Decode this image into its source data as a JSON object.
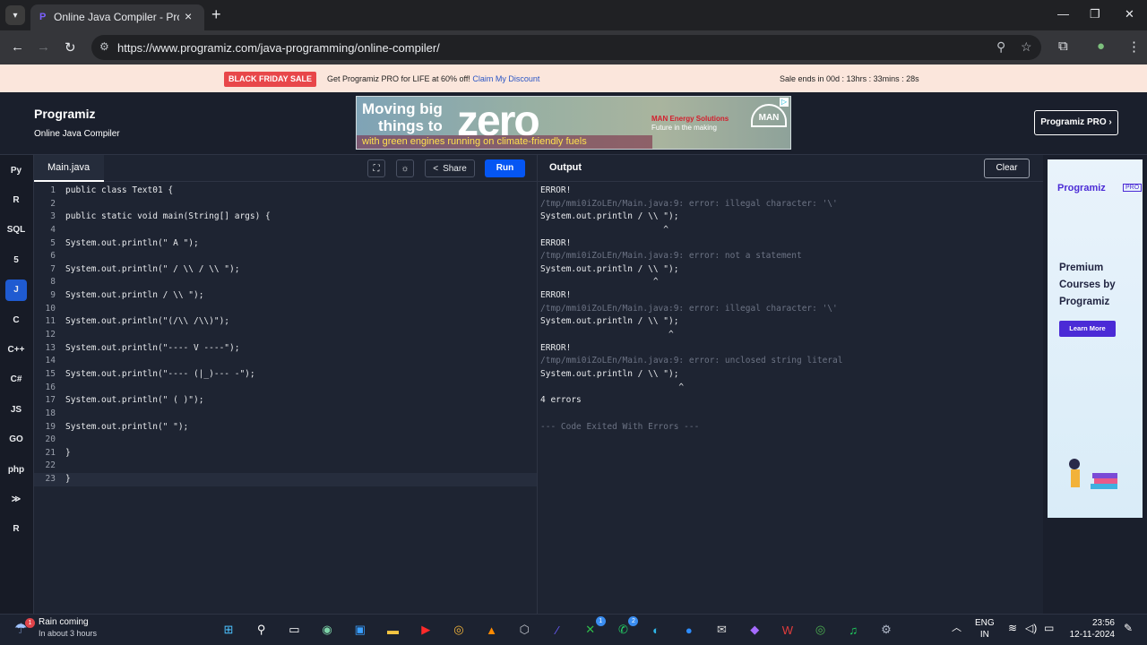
{
  "browser": {
    "tab_title": "Online Java Compiler - Program",
    "url": "https://www.programiz.com/java-programming/online-compiler/"
  },
  "promo": {
    "badge": "BLACK FRIDAY SALE",
    "message": "Get Programiz PRO for LIFE at 60% off!",
    "link": "Claim My Discount",
    "countdown": "Sale ends in 00d : 13hrs : 33mins : 28s"
  },
  "header": {
    "logo": "Programiz",
    "subtitle": "Online Java Compiler",
    "pro_button": "Programiz PRO ›"
  },
  "ad": {
    "line1": "Moving big",
    "line2": "things to",
    "big": "zero",
    "tagline": "with green engines running on climate-friendly fuels",
    "brand": "MAN Energy Solutions",
    "brand_sub": "Future in the making",
    "man": "MAN"
  },
  "languages": [
    {
      "label": "Py",
      "icon": "python-icon"
    },
    {
      "label": "R",
      "icon": "r-icon"
    },
    {
      "label": "SQL",
      "icon": "database-icon"
    },
    {
      "label": "5",
      "icon": "html5-icon"
    },
    {
      "label": "J",
      "icon": "java-icon"
    },
    {
      "label": "C",
      "icon": "c-icon"
    },
    {
      "label": "C++",
      "icon": "cpp-icon"
    },
    {
      "label": "C#",
      "icon": "csharp-icon"
    },
    {
      "label": "JS",
      "icon": "js-icon"
    },
    {
      "label": "GO",
      "icon": "go-icon"
    },
    {
      "label": "php",
      "icon": "php-icon"
    },
    {
      "label": "≫",
      "icon": "swift-icon"
    },
    {
      "label": "R",
      "icon": "rust-icon"
    }
  ],
  "editor": {
    "file_tab": "Main.java",
    "share": "Share",
    "run": "Run",
    "lines": [
      "public class Text01 {",
      "",
      "public static void main(String[] args) {",
      "",
      "System.out.println(\" A \");",
      "",
      "System.out.println(\" / \\\\ / \\\\ \");",
      "",
      "System.out.println / \\\\ \");",
      "",
      "System.out.println(\"(/\\\\ /\\\\)\");",
      "",
      "System.out.println(\"---- V ----\");",
      "",
      "System.out.println(\"---- (|_)--- -\");",
      "",
      "System.out.println(\" ( )\");",
      "",
      "System.out.println(\" \");",
      "",
      "}",
      "",
      "}"
    ]
  },
  "output": {
    "title": "Output",
    "clear": "Clear",
    "lines": [
      {
        "text": "ERROR!",
        "dim": false
      },
      {
        "text": "/tmp/mmi0iZoLEn/Main.java:9: error: illegal character: '\\'",
        "dim": true
      },
      {
        "text": "System.out.println / \\\\ \");",
        "dim": false
      },
      {
        "text": "                        ^",
        "dim": false
      },
      {
        "text": "ERROR!",
        "dim": false
      },
      {
        "text": "/tmp/mmi0iZoLEn/Main.java:9: error: not a statement",
        "dim": true
      },
      {
        "text": "System.out.println / \\\\ \");",
        "dim": false
      },
      {
        "text": "                      ^",
        "dim": false
      },
      {
        "text": "ERROR!",
        "dim": false
      },
      {
        "text": "/tmp/mmi0iZoLEn/Main.java:9: error: illegal character: '\\'",
        "dim": true
      },
      {
        "text": "System.out.println / \\\\ \");",
        "dim": false
      },
      {
        "text": "                         ^",
        "dim": false
      },
      {
        "text": "ERROR!",
        "dim": false
      },
      {
        "text": "/tmp/mmi0iZoLEn/Main.java:9: error: unclosed string literal",
        "dim": true
      },
      {
        "text": "System.out.println / \\\\ \");",
        "dim": false
      },
      {
        "text": "                           ^",
        "dim": false
      },
      {
        "text": "4 errors",
        "dim": false
      },
      {
        "text": "",
        "dim": false
      },
      {
        "text": "--- Code Exited With Errors ---",
        "dim": true
      }
    ]
  },
  "side_ad": {
    "logo": "Programiz",
    "pro": "PRO",
    "headline": "Premium Courses by Programiz",
    "button": "Learn More"
  },
  "taskbar": {
    "weather_title": "Rain coming",
    "weather_sub": "In about 3 hours",
    "weather_badge": "1",
    "lang_top": "ENG",
    "lang_bottom": "IN",
    "time": "23:56",
    "date": "12-11-2024",
    "apps": [
      {
        "name": "start-icon",
        "glyph": "⊞",
        "color": "#4cc2ff",
        "badge": ""
      },
      {
        "name": "search-icon",
        "glyph": "⚲",
        "color": "#ffffff",
        "badge": ""
      },
      {
        "name": "task-view-icon",
        "glyph": "▭",
        "color": "#ffffff",
        "badge": ""
      },
      {
        "name": "copilot-icon",
        "glyph": "◉",
        "color": "#7dd3a8",
        "badge": ""
      },
      {
        "name": "store-icon",
        "glyph": "▣",
        "color": "#3aa0ff",
        "badge": ""
      },
      {
        "name": "file-explorer-icon",
        "glyph": "▬",
        "color": "#f4c542",
        "badge": ""
      },
      {
        "name": "youtube-icon",
        "glyph": "▶",
        "color": "#ff2a2a",
        "badge": ""
      },
      {
        "name": "chrome-icon",
        "glyph": "◎",
        "color": "#f2b43a",
        "badge": ""
      },
      {
        "name": "vlc-icon",
        "glyph": "▲",
        "color": "#ff8a00",
        "badge": ""
      },
      {
        "name": "box-icon",
        "glyph": "⬡",
        "color": "#c0c4cc",
        "badge": ""
      },
      {
        "name": "editor-icon",
        "glyph": "⁄",
        "color": "#6a5cff",
        "badge": ""
      },
      {
        "name": "xbox-icon",
        "glyph": "✕",
        "color": "#2fbf4a",
        "badge": "1"
      },
      {
        "name": "whatsapp-icon",
        "glyph": "✆",
        "color": "#25d366",
        "badge": "2"
      },
      {
        "name": "edge-icon",
        "glyph": "◐",
        "color": "#2fb6e8",
        "badge": ""
      },
      {
        "name": "zoom-icon",
        "glyph": "●",
        "color": "#2d8cff",
        "badge": ""
      },
      {
        "name": "mail-icon",
        "glyph": "✉",
        "color": "#d8d8d8",
        "badge": ""
      },
      {
        "name": "m365-icon",
        "glyph": "◆",
        "color": "#a56bff",
        "badge": ""
      },
      {
        "name": "wps-icon",
        "glyph": "W",
        "color": "#e23c3c",
        "badge": ""
      },
      {
        "name": "chrome-active-icon",
        "glyph": "◎",
        "color": "#4caf50",
        "badge": ""
      },
      {
        "name": "spotify-icon",
        "glyph": "♫",
        "color": "#1ed760",
        "badge": ""
      },
      {
        "name": "settings-icon",
        "glyph": "⚙",
        "color": "#b0b8c8",
        "badge": ""
      }
    ]
  }
}
